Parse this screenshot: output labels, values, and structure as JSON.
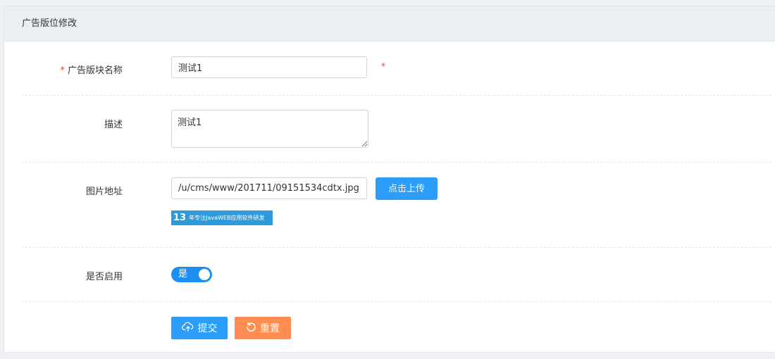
{
  "header": {
    "title": "广告版位修改"
  },
  "form": {
    "name": {
      "required_mark": "*",
      "label": "广告版块名称",
      "value": "测试1",
      "side_mark": "*"
    },
    "description": {
      "label": "描述",
      "value": "测试1"
    },
    "image": {
      "label": "图片地址",
      "value": "/u/cms/www/201711/09151534cdtx.jpg",
      "upload_label": "点击上传",
      "preview": {
        "number": "13",
        "text": "年专注JavaWEB应用软件研发"
      }
    },
    "enabled": {
      "label": "是否启用",
      "toggle_text": "是",
      "on": true
    },
    "actions": {
      "submit_label": "提交",
      "reset_label": "重置"
    }
  },
  "colors": {
    "primary": "#2d9dfa",
    "reset": "#ff8d52",
    "required": "#e2423f",
    "toggle_on": "#1e8ff2"
  }
}
